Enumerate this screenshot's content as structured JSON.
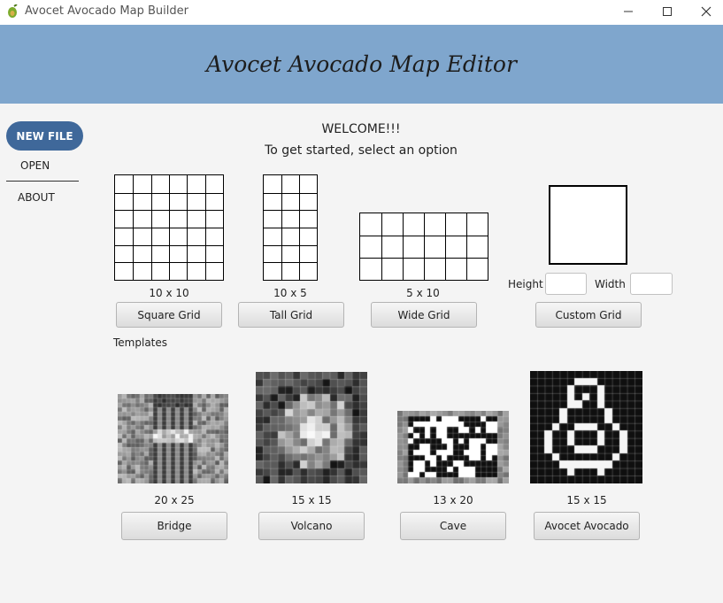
{
  "window": {
    "title": "Avocet Avocado Map Builder",
    "controls": [
      "minimize-icon",
      "maximize-icon",
      "close-icon"
    ]
  },
  "banner": {
    "title": "Avocet Avocado Map Editor",
    "color": "#7fa6cd"
  },
  "sidebar": {
    "new_file": "NEW FILE",
    "open": "OPEN",
    "about": "ABOUT",
    "accent": "#3f689a"
  },
  "welcome": {
    "line1": "WELCOME!!!",
    "line2": "To get started, select an option"
  },
  "grids": [
    {
      "size": "10 x 10",
      "button": "Square Grid"
    },
    {
      "size": "10 x 5",
      "button": "Tall Grid"
    },
    {
      "size": "5 x 10",
      "button": "Wide Grid"
    }
  ],
  "custom": {
    "height_label": "Height",
    "width_label": "Width",
    "height_value": "",
    "width_value": "",
    "button": "Custom Grid"
  },
  "templates": {
    "heading": "Templates",
    "items": [
      {
        "size": "20 x 25",
        "button": "Bridge"
      },
      {
        "size": "15 x 15",
        "button": "Volcano"
      },
      {
        "size": "13 x 20",
        "button": "Cave"
      },
      {
        "size": "15 x 15",
        "button": "Avocet Avocado"
      }
    ]
  }
}
